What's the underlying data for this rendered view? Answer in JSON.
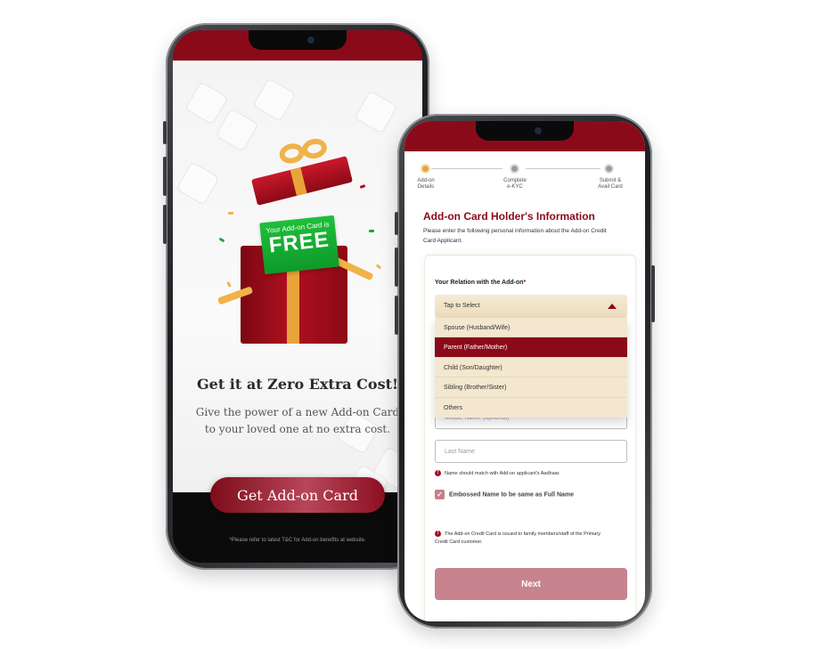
{
  "phone1": {
    "gift_tag_small": "Your Add-on Card is",
    "gift_tag_big": "FREE",
    "title": "Get it at Zero Extra Cost!",
    "description": "Give the power of a new Add-on Card to your loved one at no extra cost.",
    "carousel": {
      "total": 5,
      "active_index": 0
    },
    "cta_label": "Get Add-on Card",
    "footnote": "*Please refer to latest T&C for Add-on benefits at website."
  },
  "phone2": {
    "steps": [
      {
        "label_line1": "Add-on",
        "label_line2": "Details",
        "state": "active"
      },
      {
        "label_line1": "Complete",
        "label_line2": "e-KYC",
        "state": "pending"
      },
      {
        "label_line1": "Submit &",
        "label_line2": "Avail Card",
        "state": "pending"
      }
    ],
    "title": "Add-on Card Holder's Information",
    "subtitle": "Please enter the following personal information about the Add-on Credit Card Applicant.",
    "relation_label": "Your Relation with the Add-on",
    "required_mark": "*",
    "select_placeholder": "Tap to Select",
    "options": [
      "Spouse (Husband/Wife)",
      "Parent (Father/Mother)",
      "Child (Son/Daughter)",
      "Sibling (Brother/Sister)",
      "Others"
    ],
    "highlighted_option": "Parent (Father/Mother)",
    "middle_name_placeholder": "Middle Name (optional)",
    "last_name_placeholder": "Last Name",
    "name_note": "Name should match with Add-on applicant's Aadhaar.",
    "embossed_label": "Embossed Name to be same as Full Name",
    "embossed_checked": true,
    "issue_note": "The Add-on Credit Card is issued to family members/staff of the Primary Credit Card customer.",
    "next_label": "Next"
  },
  "colors": {
    "brand_maroon": "#8b0a1a",
    "accent_gold": "#e8a33a",
    "dropdown_bg": "#f3e7cf",
    "free_green": "#14ab32"
  }
}
